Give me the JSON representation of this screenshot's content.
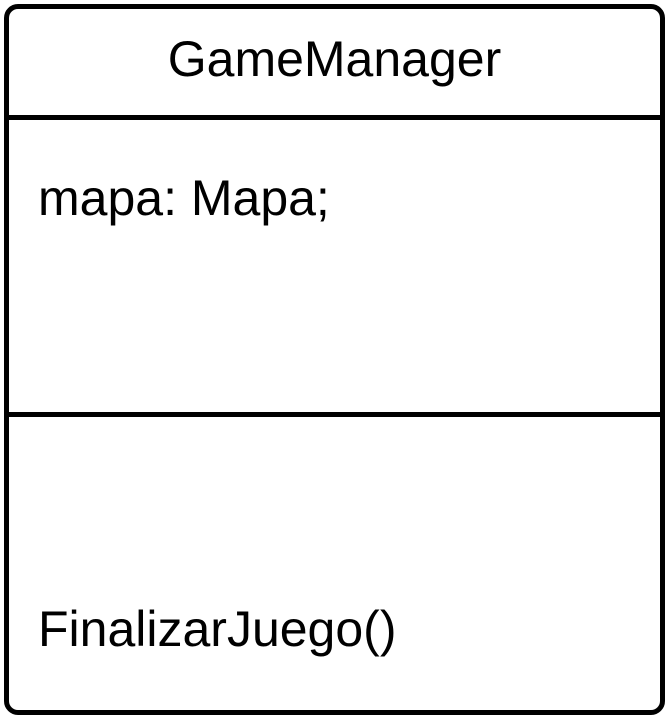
{
  "class": {
    "name": "GameManager",
    "attributes": [
      "mapa: Mapa;"
    ],
    "methods": [
      "FinalizarJuego()"
    ]
  }
}
